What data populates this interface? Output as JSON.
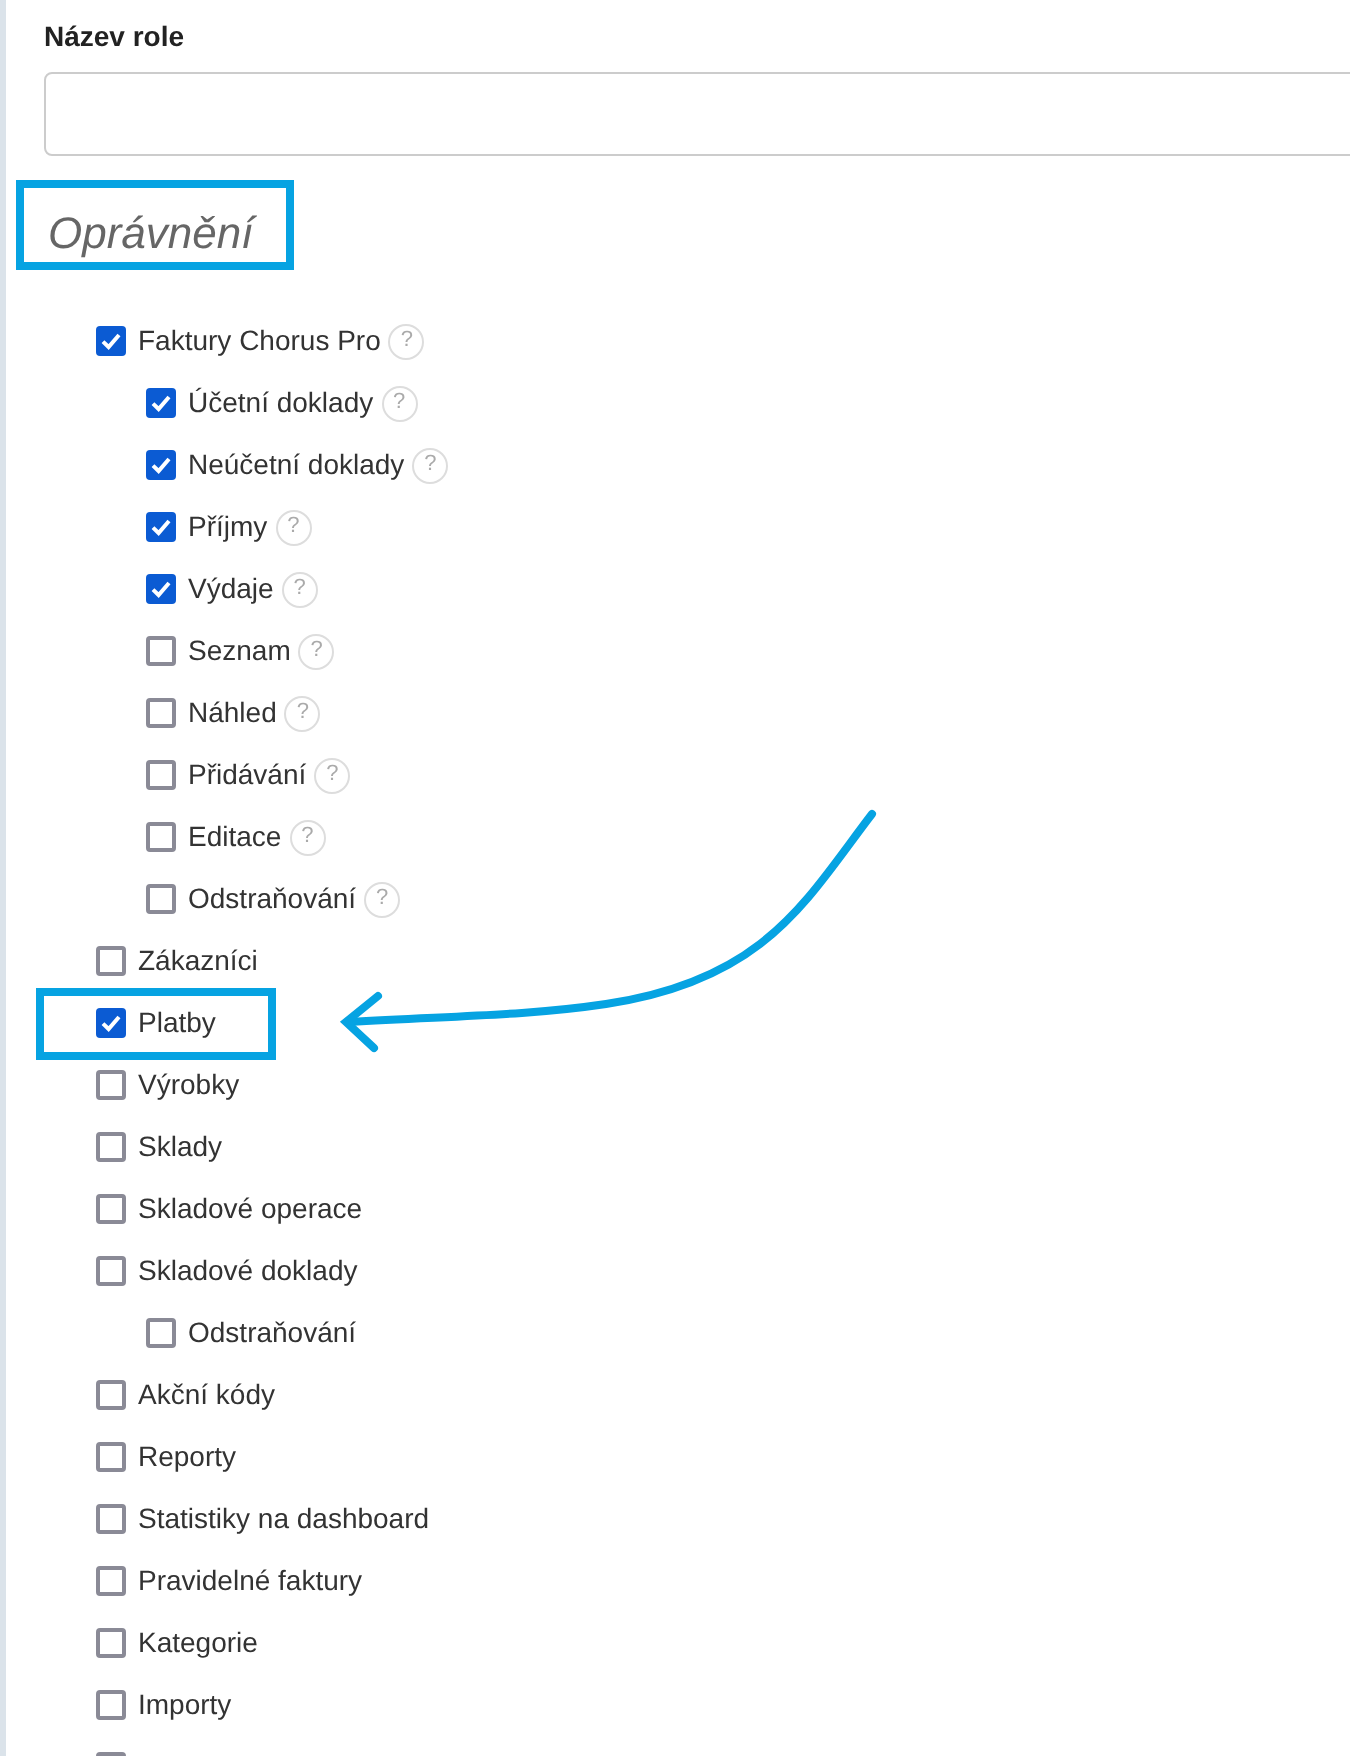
{
  "form": {
    "name_label": "Název role",
    "section_title": "Oprávnění"
  },
  "permissions": [
    {
      "label": "Faktury Chorus Pro",
      "help": "?",
      "checked": true,
      "children": [
        {
          "label": "Účetní doklady",
          "help": "?",
          "checked": true
        },
        {
          "label": "Neúčetní doklady",
          "help": "?",
          "checked": true
        },
        {
          "label": "Příjmy",
          "help": "?",
          "checked": true
        },
        {
          "label": "Výdaje",
          "help": "?",
          "checked": true
        },
        {
          "label": "Seznam",
          "help": "?",
          "checked": false
        },
        {
          "label": "Náhled",
          "help": "?",
          "checked": false
        },
        {
          "label": "Přidávání",
          "help": "?",
          "checked": false
        },
        {
          "label": "Editace",
          "help": "?",
          "checked": false
        },
        {
          "label": "Odstraňování",
          "help": "?",
          "checked": false
        }
      ]
    },
    {
      "label": "Zákazníci",
      "checked": false
    },
    {
      "label": "Platby",
      "checked": true
    },
    {
      "label": "Výrobky",
      "checked": false
    },
    {
      "label": "Sklady",
      "checked": false
    },
    {
      "label": "Skladové operace",
      "checked": false
    },
    {
      "label": "Skladové doklady",
      "checked": false,
      "children": [
        {
          "label": "Odstraňování",
          "checked": false
        }
      ]
    },
    {
      "label": "Akční kódy",
      "checked": false
    },
    {
      "label": "Reporty",
      "checked": false
    },
    {
      "label": "Statistiky na dashboard",
      "checked": false
    },
    {
      "label": "Pravidelné faktury",
      "checked": false
    },
    {
      "label": "Kategorie",
      "checked": false
    },
    {
      "label": "Importy",
      "checked": false
    },
    {
      "checked": false
    }
  ]
}
